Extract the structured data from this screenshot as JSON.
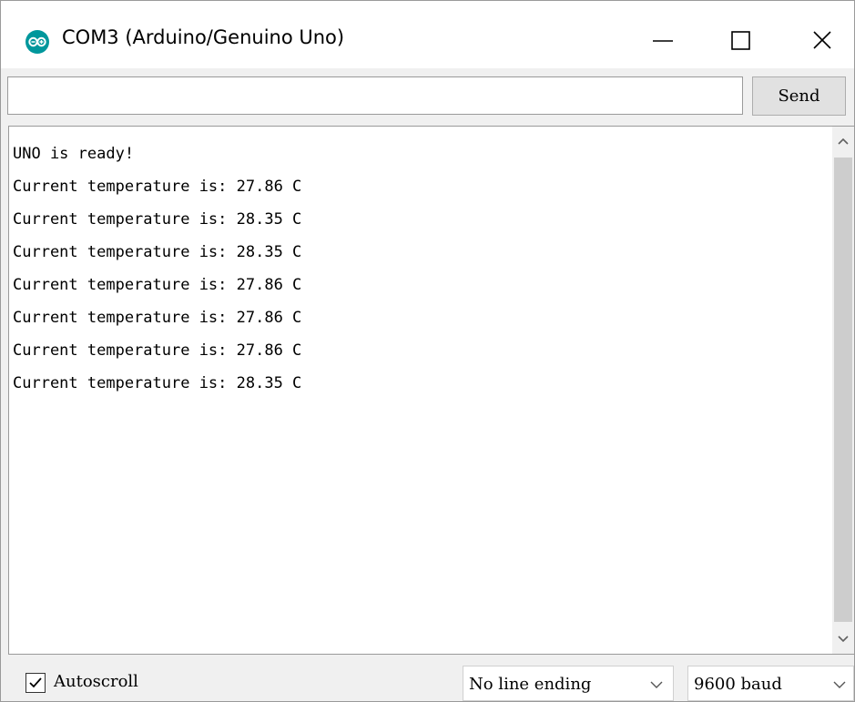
{
  "window": {
    "title": "COM3 (Arduino/Genuino Uno)",
    "icon": "arduino-logo-icon"
  },
  "titlebar_buttons": {
    "minimize_icon": "minimize-icon",
    "maximize_icon": "maximize-icon",
    "close_icon": "close-icon"
  },
  "input_row": {
    "value": "",
    "placeholder": "",
    "send_label": "Send"
  },
  "output": {
    "lines": [
      "UNO is ready!",
      "Current temperature is: 27.86 C",
      "Current temperature is: 28.35 C",
      "Current temperature is: 28.35 C",
      "Current temperature is: 27.86 C",
      "Current temperature is: 27.86 C",
      "Current temperature is: 27.86 C",
      "Current temperature is: 28.35 C"
    ]
  },
  "bottombar": {
    "autoscroll_checked": true,
    "autoscroll_label": "Autoscroll",
    "line_ending_selected": "No line ending",
    "baud_selected": "9600 baud"
  },
  "colors": {
    "arduino_teal": "#00979c",
    "window_bg": "#f0f0f0",
    "border": "#9a9a9a"
  }
}
